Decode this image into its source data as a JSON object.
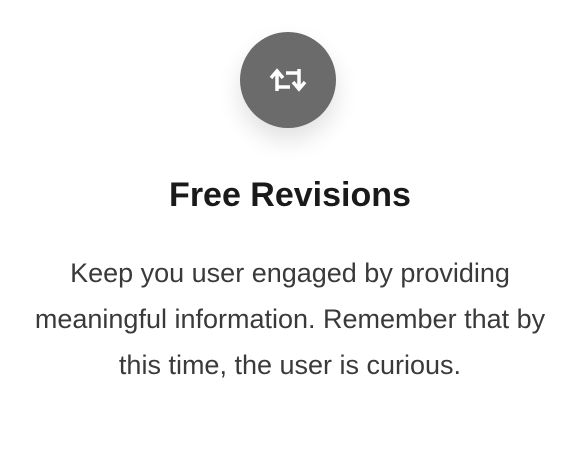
{
  "feature": {
    "icon": "repeat-icon",
    "icon_bg": "#6b6b6b",
    "title": "Free Revisions",
    "description": "Keep you user engaged by providing meaningful information. Remember that by this time, the user is curious."
  }
}
